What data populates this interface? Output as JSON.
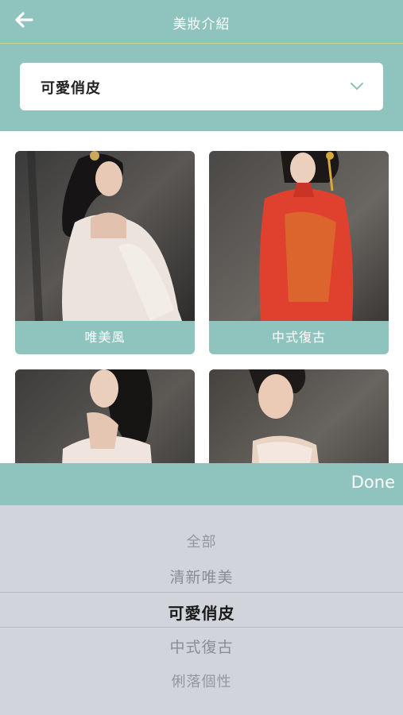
{
  "colors": {
    "accent": "#8fc3be",
    "picker_bg": "#d1d5db"
  },
  "header": {
    "back_icon": "arrow-left-icon",
    "title": "美妝介紹"
  },
  "filter": {
    "selected": "可愛俏皮",
    "chevron_icon": "chevron-down-icon"
  },
  "cards": [
    {
      "label": "唯美風"
    },
    {
      "label": "中式復古"
    },
    {
      "label": ""
    },
    {
      "label": ""
    }
  ],
  "picker": {
    "done_label": "Done",
    "options": [
      "全部",
      "清新唯美",
      "可愛俏皮",
      "中式復古",
      "俐落個性"
    ],
    "selected_index": 2
  }
}
